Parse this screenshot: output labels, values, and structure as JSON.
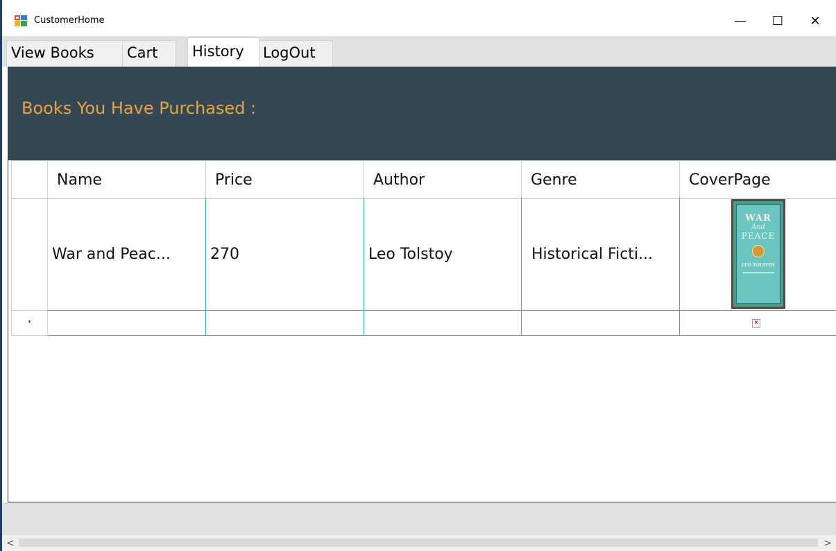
{
  "window": {
    "title": "CustomerHome",
    "icon": "winforms-app-icon",
    "minimize_icon": "—",
    "maximize_icon": "☐",
    "close_icon": "✕"
  },
  "tabs": [
    {
      "label": "View Books",
      "active": false
    },
    {
      "label": "Cart",
      "active": false
    },
    {
      "label": "History",
      "active": true
    },
    {
      "label": "LogOut",
      "active": false
    }
  ],
  "header": {
    "title": "Books You Have Purchased :",
    "background": "#344854",
    "title_color": "#e8a33a"
  },
  "grid": {
    "columns": [
      "Name",
      "Price",
      "Author",
      "Genre",
      "CoverPage"
    ],
    "rows": [
      {
        "name": "War and Peac...",
        "price": "270",
        "author": "Leo Tolstoy",
        "genre": "Historical Ficti...",
        "cover": {
          "line1": "WAR",
          "line2": "And",
          "line3": "PEACE",
          "line4": "LEO TOLSTOY"
        }
      }
    ],
    "new_row_marker": "*",
    "new_row_cover_icon": "broken-image-icon",
    "broken_image_glyph": "×",
    "grid_line_color": "#29b6b6"
  },
  "scrollbar": {
    "left_arrow": "<",
    "right_arrow": ">"
  }
}
